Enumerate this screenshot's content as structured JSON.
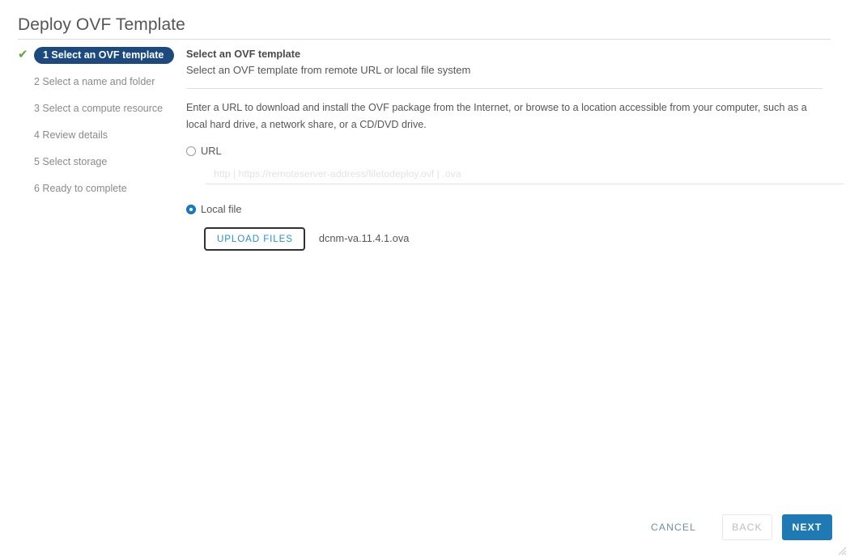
{
  "window": {
    "title": "Deploy OVF Template"
  },
  "steps": [
    {
      "label": "1 Select an OVF template",
      "active": true,
      "completed": true
    },
    {
      "label": "2 Select a name and folder",
      "active": false,
      "completed": false
    },
    {
      "label": "3 Select a compute resource",
      "active": false,
      "completed": false
    },
    {
      "label": "4 Review details",
      "active": false,
      "completed": false
    },
    {
      "label": "5 Select storage",
      "active": false,
      "completed": false
    },
    {
      "label": "6 Ready to complete",
      "active": false,
      "completed": false
    }
  ],
  "content": {
    "heading": "Select an OVF template",
    "subheading": "Select an OVF template from remote URL or local file system",
    "description": "Enter a URL to download and install the OVF package from the Internet, or browse to a location accessible from your computer, such as a local hard drive, a network share, or a CD/DVD drive.",
    "url_option": {
      "label": "URL",
      "selected": false,
      "input_value": "",
      "input_placeholder": "http | https://remoteserver-address/filetodeploy.ovf | .ova"
    },
    "local_file_option": {
      "label": "Local file",
      "selected": true,
      "upload_button_label": "UPLOAD FILES",
      "selected_filename": "dcnm-va.11.4.1.ova"
    }
  },
  "footer": {
    "cancel_label": "CANCEL",
    "back_label": "BACK",
    "next_label": "NEXT"
  },
  "icons": {
    "check": "✔"
  },
  "colors": {
    "active_step_bg": "#1c4a7e",
    "check_green": "#5aab3c",
    "primary_blue": "#1f7ab4",
    "link_blue": "#2a8fd0",
    "cancel_blue": "#6b8fa8",
    "text_gray": "#565656",
    "muted_gray": "#8a8a8a"
  }
}
